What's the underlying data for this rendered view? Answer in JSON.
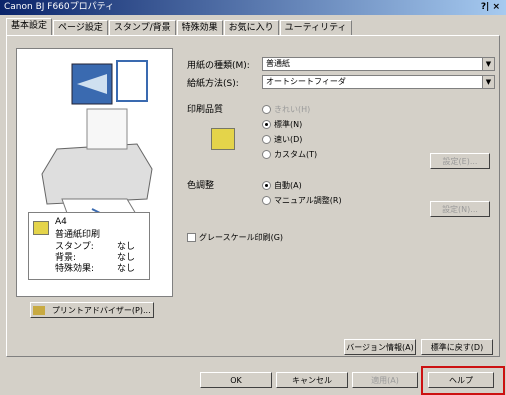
{
  "window": {
    "title": "Canon BJ F660プロパティ",
    "controls": "?| ×"
  },
  "tabs": [
    "基本設定",
    "ページ設定",
    "スタンプ/背景",
    "特殊効果",
    "お気に入り",
    "ユーティリティ"
  ],
  "settings": {
    "media_label": "用紙の種類(M):",
    "media_value": "普通紙",
    "feed_label": "給紙方法(S):",
    "feed_value": "オートシートフィーダ",
    "quality_label": "印刷品質",
    "quality_options": [
      "きれい(H)",
      "標準(N)",
      "速い(D)",
      "カスタム(T)"
    ],
    "quality_selected": 1,
    "quality_button": "設定(E)...",
    "color_label": "色調整",
    "color_options": [
      "自動(A)",
      "マニュアル調整(R)"
    ],
    "color_selected": 0,
    "color_button": "設定(N)...",
    "grayscale_label": "グレースケール印刷(G)"
  },
  "info": {
    "line1": "A4",
    "line2": "普通紙印刷",
    "rows": [
      {
        "k": "スタンプ:",
        "v": "なし"
      },
      {
        "k": "背景:",
        "v": "なし"
      },
      {
        "k": "特殊効果:",
        "v": "なし"
      }
    ]
  },
  "advisor_button": "プリントアドバイザー(P)...",
  "version_button": "バージョン情報(A)",
  "defaults_button": "標準に戻す(D)",
  "dialog_buttons": {
    "ok": "OK",
    "cancel": "キャンセル",
    "apply": "適用(A)",
    "help": "ヘルプ"
  }
}
